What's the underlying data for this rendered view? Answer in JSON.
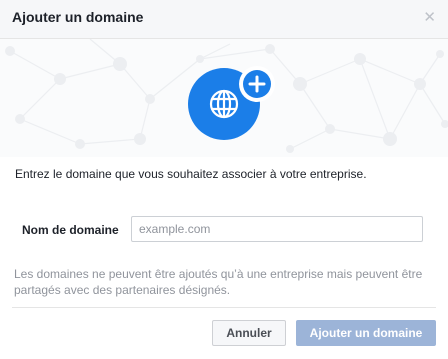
{
  "dialog": {
    "title": "Ajouter un domaine",
    "close_icon": "close-icon",
    "close_glyph": "✕"
  },
  "hero": {
    "main_icon": "globe-icon",
    "badge_icon": "plus-icon"
  },
  "instruction": "Entrez le domaine que vous souhaitez associer à votre entreprise.",
  "field": {
    "label": "Nom de domaine",
    "value": "",
    "placeholder": "example.com"
  },
  "note": "Les domaines ne peuvent être ajoutés qu’à une entreprise mais peuvent être partagés avec des partenaires désignés.",
  "buttons": {
    "cancel": "Annuler",
    "submit": "Ajouter un domaine",
    "submit_disabled": true
  },
  "colors": {
    "accent": "#1b7ee8",
    "disabled_primary": "#9cb4d8",
    "muted_text": "#90949c"
  }
}
